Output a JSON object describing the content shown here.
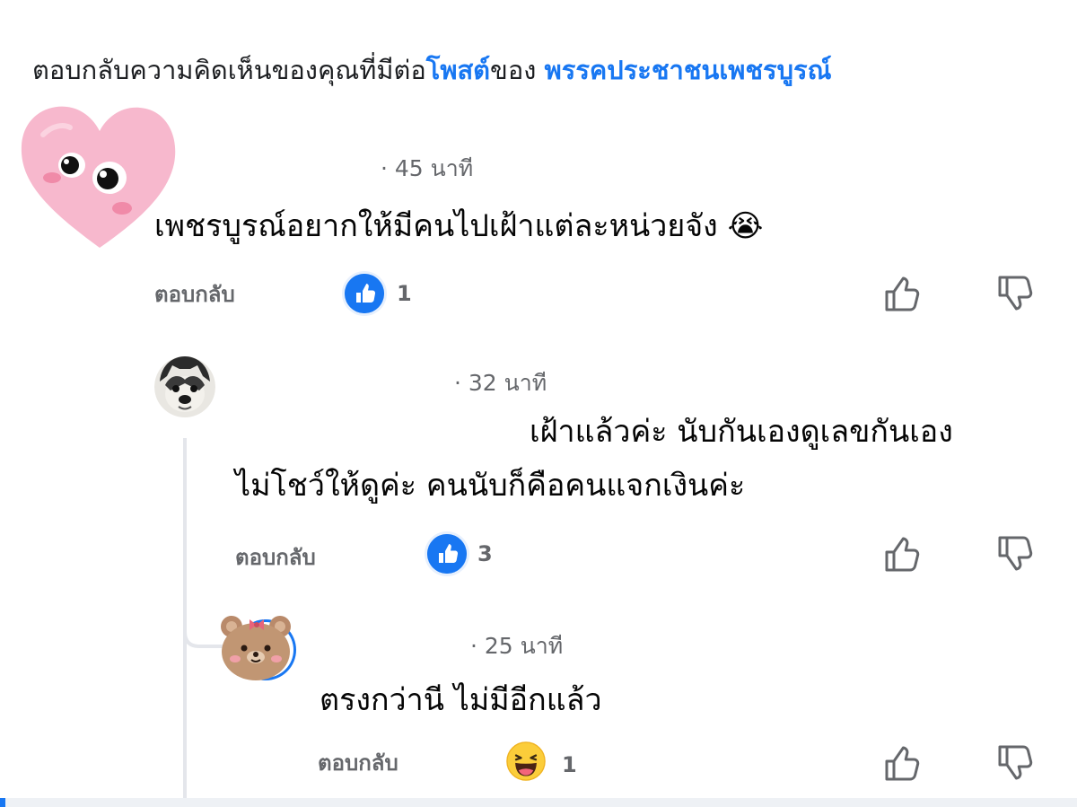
{
  "header": {
    "prefix": "ตอบกลับความคิดเห็นของคุณที่มีต่อ",
    "post_link": "โพสต์",
    "of_text": "ของ",
    "page_name": "พรรคประชาชนเพชรบูรณ์"
  },
  "comments": [
    {
      "timestamp": "· 45 นาที",
      "text": "เพชรบูรณ์อยากให้มีคนไปเฝ้าแต่ละหน่วยจัง",
      "emoji": "😭",
      "reply_label": "ตอบกลับ",
      "reaction": "like",
      "reaction_count": "1"
    },
    {
      "timestamp": "· 32 นาที",
      "text_line1": "เฝ้าแล้วค่ะ นับกันเองดูเลขกันเอง",
      "text_line2": "ไม่โชว์ให้ดูค่ะ คนนับก็คือคนแจกเงินค่ะ",
      "reply_label": "ตอบกลับ",
      "reaction": "like",
      "reaction_count": "3"
    },
    {
      "timestamp": "· 25 นาที",
      "text": "ตรงกว่านี ไม่มีอีกแล้ว",
      "reply_label": "ตอบกลับ",
      "reaction": "haha",
      "reaction_count": "1"
    }
  ],
  "icons": {
    "like_reaction": "like-reaction-icon",
    "haha_reaction": "haha-reaction-icon",
    "thumbs_up": "thumbs-up-icon",
    "thumbs_down": "thumbs-down-icon"
  },
  "colors": {
    "link": "#1877f2",
    "secondary_text": "#65676b",
    "thread_line": "#e4e6eb"
  }
}
